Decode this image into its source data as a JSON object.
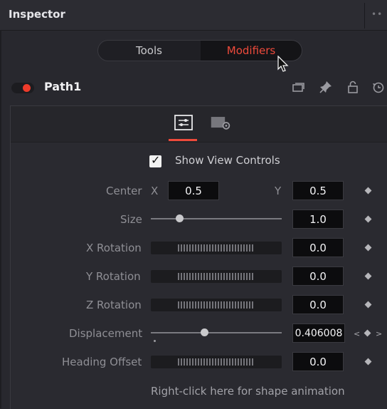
{
  "window": {
    "title": "Inspector",
    "more_icon": "ellipsis-icon"
  },
  "tabs": [
    {
      "label": "Tools",
      "active": false
    },
    {
      "label": "Modifiers",
      "active": true
    }
  ],
  "node": {
    "name": "Path1",
    "enabled": true,
    "icons": [
      "versions-icon",
      "pin-icon",
      "lock-icon",
      "reset-icon"
    ]
  },
  "panel_tabs": [
    "controls-icon",
    "settings-icon"
  ],
  "show_view_controls": {
    "label": "Show View Controls",
    "checked": true
  },
  "controls": {
    "center": {
      "label": "Center",
      "x_label": "X",
      "x_value": "0.5",
      "y_label": "Y",
      "y_value": "0.5"
    },
    "size": {
      "label": "Size",
      "value": "1.0",
      "slider_fraction": 0.22
    },
    "x_rotation": {
      "label": "X Rotation",
      "value": "0.0"
    },
    "y_rotation": {
      "label": "Y Rotation",
      "value": "0.0"
    },
    "z_rotation": {
      "label": "Z Rotation",
      "value": "0.0"
    },
    "displacement": {
      "label": "Displacement",
      "value": "0.406008",
      "slider_fraction": 0.406
    },
    "heading_offset": {
      "label": "Heading Offset",
      "value": "0.0"
    }
  },
  "footer": {
    "hint": "Right-click here for shape animation"
  },
  "colors": {
    "accent": "#ee4a3b",
    "background": "#28282e",
    "field": "#0c0c0e"
  }
}
